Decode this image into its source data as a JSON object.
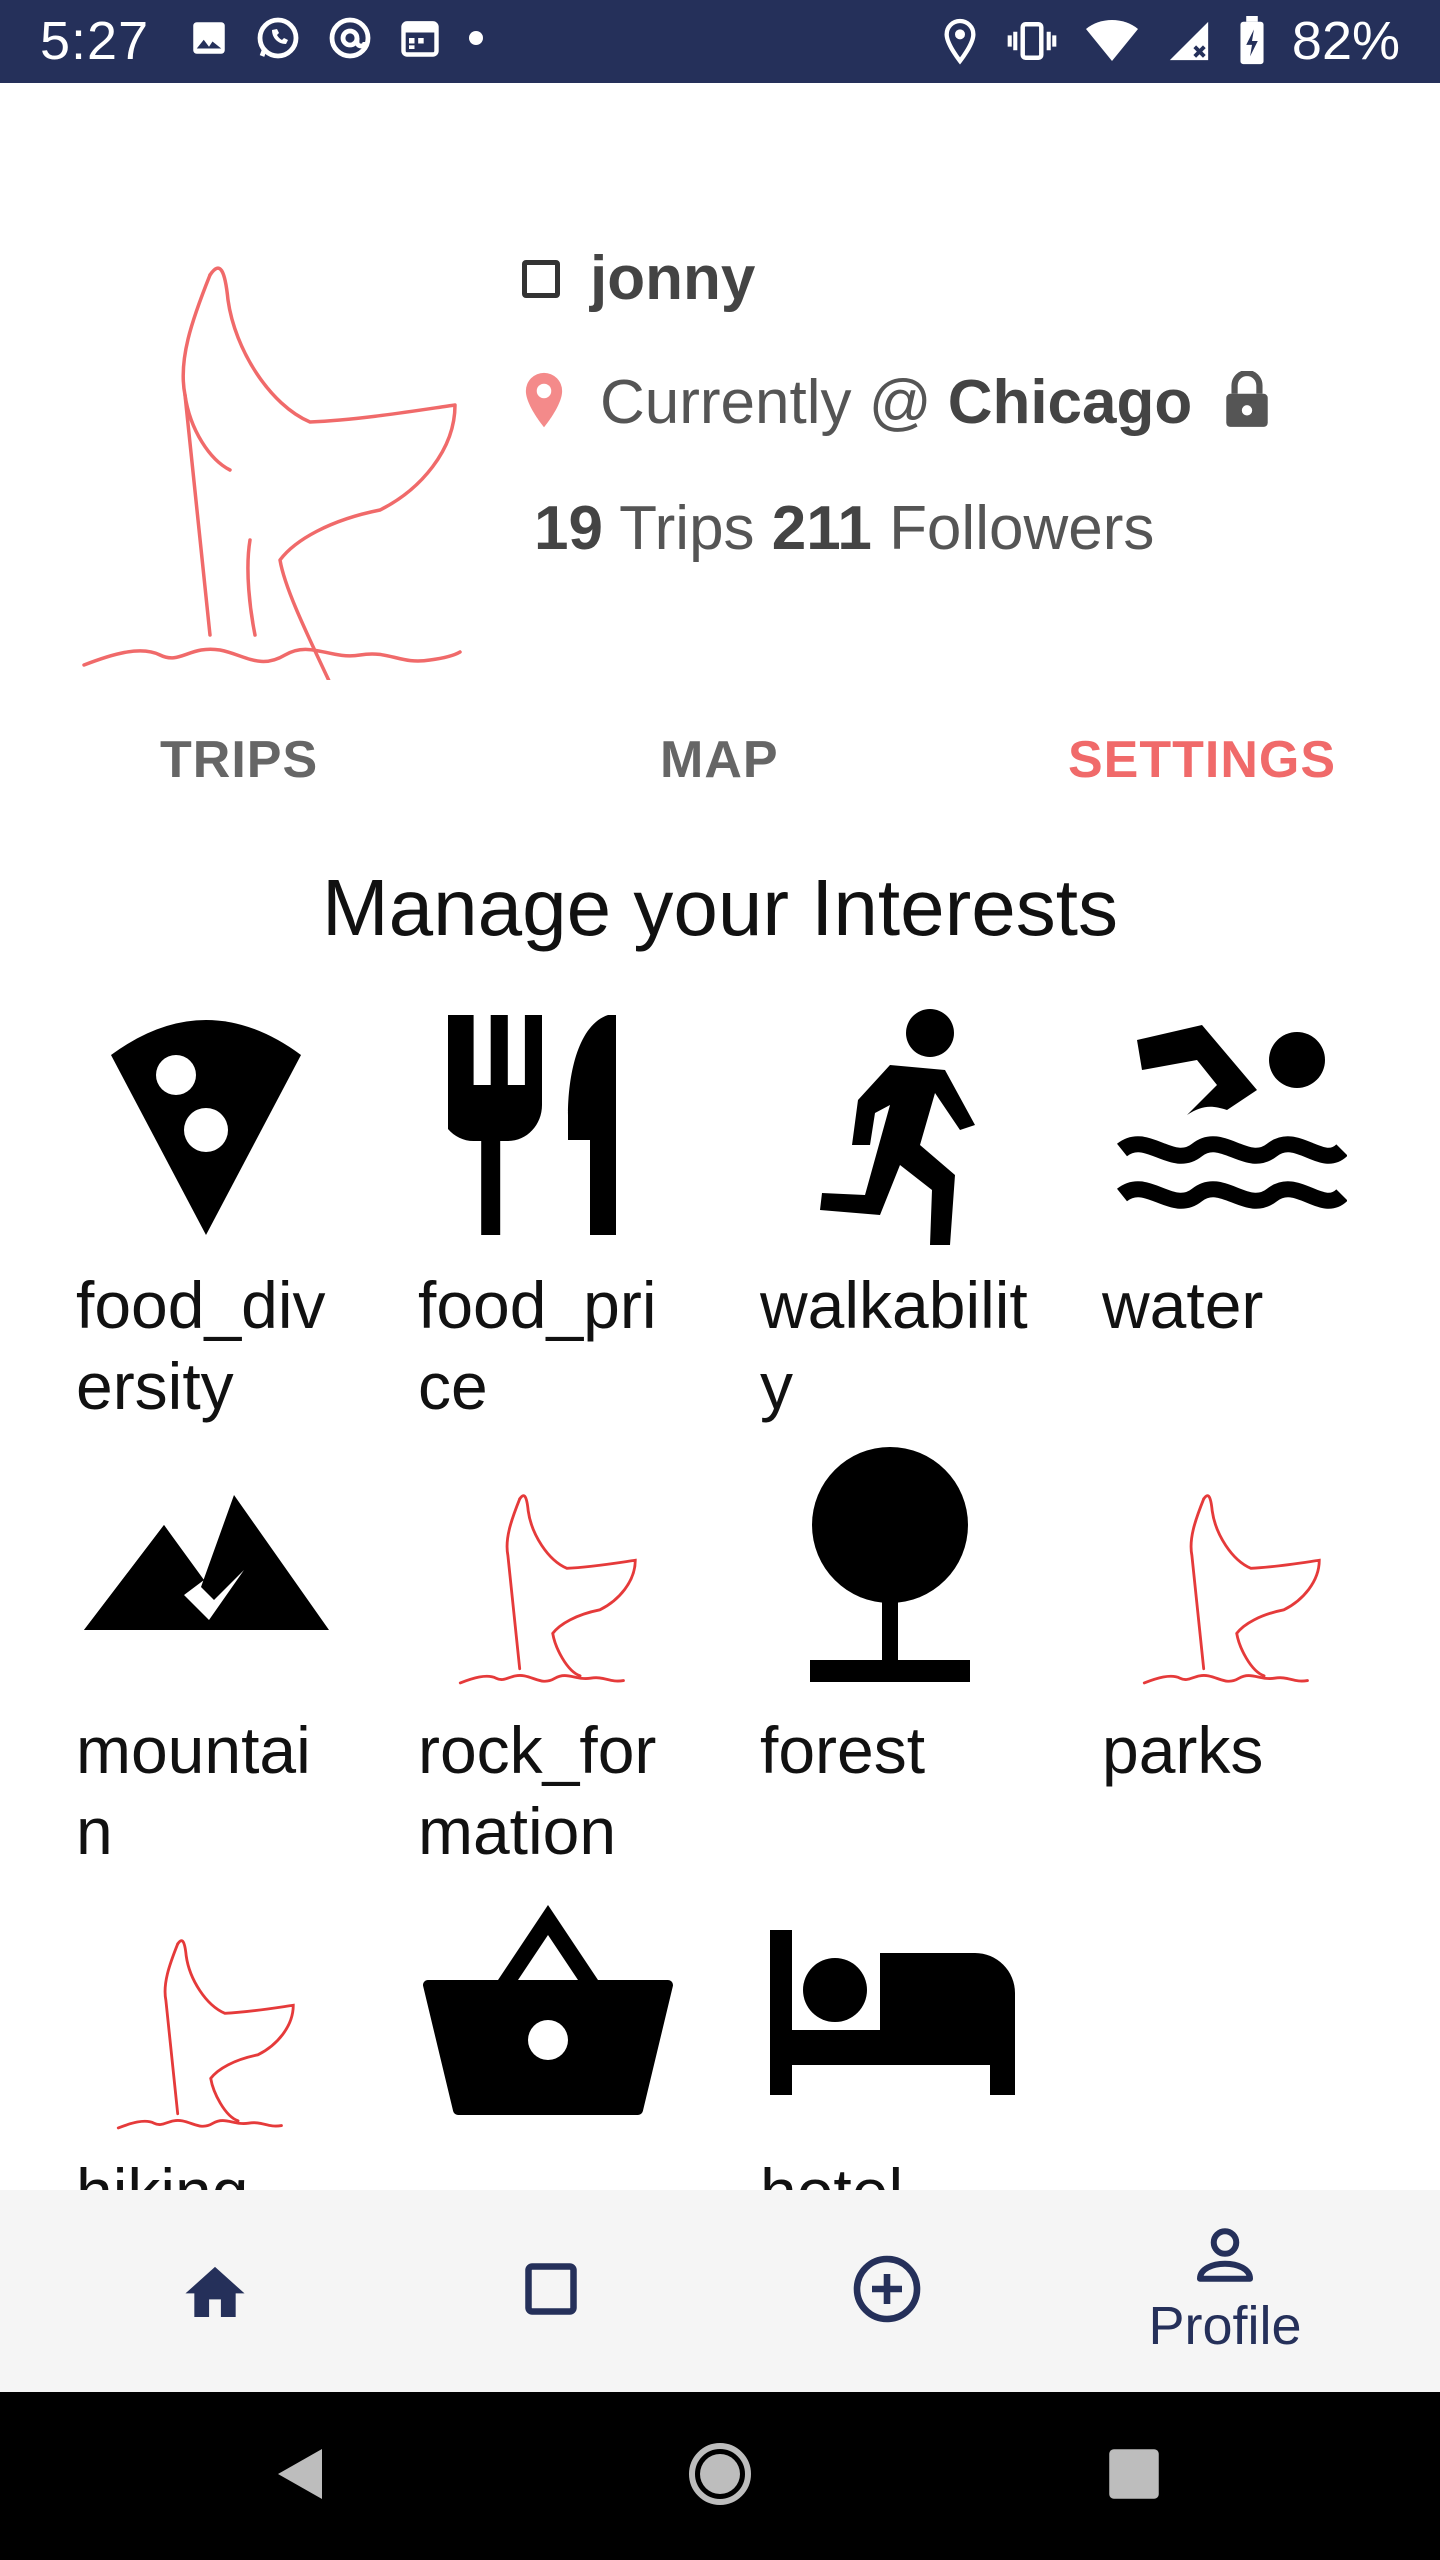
{
  "status_bar": {
    "time": "5:27",
    "battery": "82%",
    "left_icons": [
      "image-icon",
      "whatsapp-icon",
      "at-sign-icon",
      "calendar-icon",
      "dot-icon"
    ],
    "right_icons": [
      "location-pin-icon",
      "vibrate-icon",
      "wifi-icon",
      "signal-icon",
      "battery-charging-icon"
    ]
  },
  "profile": {
    "username": "jonny",
    "location_prefix": "Currently @",
    "location_city": "Chicago",
    "trips_count": "19",
    "trips_label": "Trips",
    "followers_count": "211",
    "followers_label": "Followers"
  },
  "tabs": [
    {
      "label": "TRIPS",
      "active": false
    },
    {
      "label": "MAP",
      "active": false
    },
    {
      "label": "SETTINGS",
      "active": true
    }
  ],
  "section_title": "Manage your Interests",
  "interests": [
    {
      "label": "food_diversity",
      "icon": "pizza-icon"
    },
    {
      "label": "food_price",
      "icon": "restaurant-icon"
    },
    {
      "label": "walkability",
      "icon": "walking-icon"
    },
    {
      "label": "water",
      "icon": "swimming-icon"
    },
    {
      "label": "mountain",
      "icon": "mountain-icon"
    },
    {
      "label": "rock_formation",
      "icon": "whale-tail-icon"
    },
    {
      "label": "forest",
      "icon": "tree-icon"
    },
    {
      "label": "parks",
      "icon": "whale-tail-icon"
    },
    {
      "label": "hiking",
      "icon": "whale-tail-icon"
    },
    {
      "label": "",
      "icon": "shopping-basket-icon"
    },
    {
      "label": "hotel",
      "icon": "bed-icon"
    }
  ],
  "bottom_nav": {
    "items": [
      {
        "icon": "home-icon"
      },
      {
        "icon": "square-icon"
      },
      {
        "icon": "add-circle-icon"
      },
      {
        "icon": "person-icon",
        "label": "Profile"
      }
    ]
  },
  "colors": {
    "primary": "#25305a",
    "accent": "#f06a6a",
    "nav_background": "#f5f5f5"
  }
}
